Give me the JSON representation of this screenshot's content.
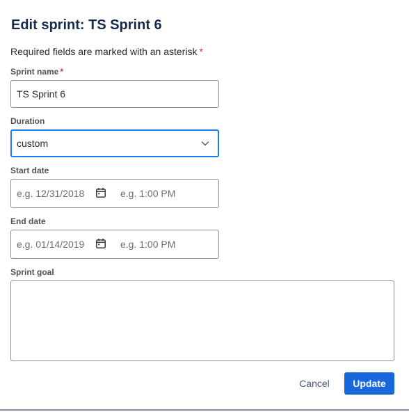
{
  "dialog": {
    "title": "Edit sprint: TS Sprint 6",
    "required_note": "Required fields are marked with an asterisk",
    "asterisk": "*"
  },
  "fields": {
    "sprint_name": {
      "label": "Sprint name",
      "value": "TS Sprint 6"
    },
    "duration": {
      "label": "Duration",
      "value": "custom"
    },
    "start_date": {
      "label": "Start date",
      "date_placeholder": "e.g. 12/31/2018",
      "time_placeholder": "e.g. 1:00 PM"
    },
    "end_date": {
      "label": "End date",
      "date_placeholder": "e.g. 01/14/2019",
      "time_placeholder": "e.g. 1:00 PM"
    },
    "sprint_goal": {
      "label": "Sprint goal",
      "value": ""
    }
  },
  "actions": {
    "cancel_label": "Cancel",
    "update_label": "Update"
  },
  "icons": {
    "duration_dropdown": "chevron-down-icon",
    "start_calendar": "calendar-icon",
    "end_calendar": "calendar-icon"
  },
  "colors": {
    "primary": "#1868db",
    "focus": "#1d7afc",
    "required": "#c9372c",
    "text": "#292a2e",
    "placeholder": "#6b6e76"
  }
}
